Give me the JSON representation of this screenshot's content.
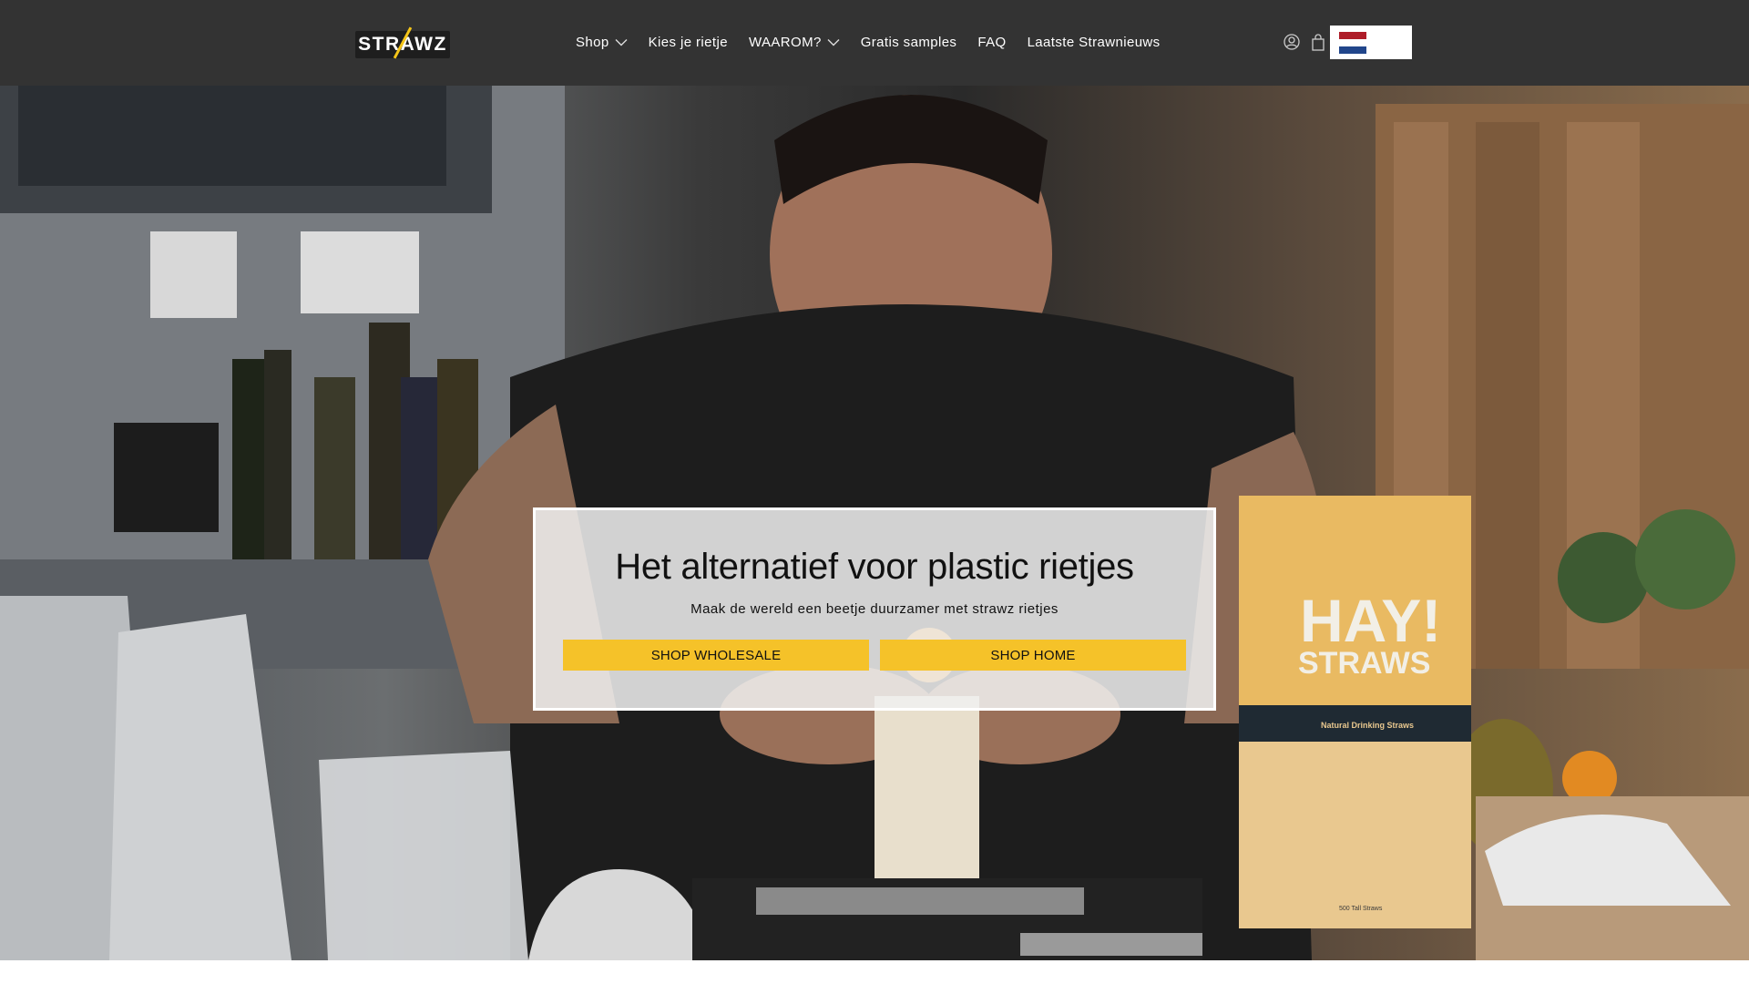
{
  "header": {
    "logo_text": "STRAWZ",
    "nav": [
      {
        "label": "Shop",
        "has_dropdown": true
      },
      {
        "label": "Kies je rietje",
        "has_dropdown": false
      },
      {
        "label": "WAAROM?",
        "has_dropdown": true
      },
      {
        "label": "Gratis samples",
        "has_dropdown": false
      },
      {
        "label": "FAQ",
        "has_dropdown": false
      },
      {
        "label": "Laatste Strawnieuws",
        "has_dropdown": false
      }
    ],
    "icons": [
      "account-icon",
      "cart-icon"
    ],
    "language": {
      "flag": "netherlands-flag",
      "colors": [
        "#ae1c28",
        "#ffffff",
        "#21468b"
      ]
    }
  },
  "hero": {
    "title": "Het alternatief voor plastic rietjes",
    "subtitle": "Maak de wereld een beetje duurzamer met strawz rietjes",
    "buttons": [
      {
        "label": "SHOP WHOLESALE"
      },
      {
        "label": "SHOP HOME"
      }
    ],
    "package_text": {
      "brand_line1": "HAY!",
      "brand_line2": "STRAWS",
      "band": "Natural Drinking Straws",
      "bottom": "500 Tall Straws"
    }
  },
  "colors": {
    "header_bg": "#333333",
    "accent": "#f5c229",
    "text_light": "#ffffff",
    "text_dark": "#111111"
  }
}
